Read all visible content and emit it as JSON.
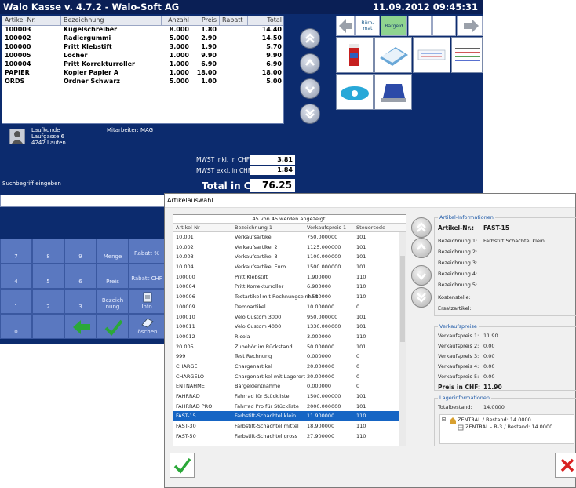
{
  "window": {
    "title": "Walo Kasse v. 4.7.2 - Walo-Soft AG",
    "datetime": "11.09.2012 09:45:31"
  },
  "cart": {
    "headers": [
      "Artikel-Nr.",
      "Bezeichnung",
      "Anzahl",
      "Preis",
      "Rabatt",
      "Total"
    ],
    "rows": [
      [
        "100003",
        "Kugelschreiber",
        "8.000",
        "1.80",
        "",
        "14.40"
      ],
      [
        "100002",
        "Radiergummi",
        "5.000",
        "2.90",
        "",
        "14.50"
      ],
      [
        "100000",
        "Pritt Klebstift",
        "3.000",
        "1.90",
        "",
        "5.70"
      ],
      [
        "100005",
        "Locher",
        "1.000",
        "9.90",
        "",
        "9.90"
      ],
      [
        "100004",
        "Pritt Korrekturroller",
        "1.000",
        "6.90",
        "",
        "6.90"
      ],
      [
        "PAPIER",
        "Kopier Papier A",
        "1.000",
        "18.00",
        "",
        "18.00"
      ],
      [
        "ORDS",
        "Ordner Schwarz",
        "5.000",
        "1.00",
        "",
        "5.00"
      ]
    ]
  },
  "customer": {
    "name": "Laufkunde",
    "street": "Laufgasse 6",
    "city": "4242 Laufen",
    "employee": "Mitarbeiter: MAG"
  },
  "totals": {
    "mwst_inkl_label": "MWST inkl. in CHF:",
    "mwst_inkl": "3.81",
    "mwst_exkl_label": "MWST exkl. in CHF:",
    "mwst_exkl": "1.84",
    "total_label": "Total in CHF:",
    "total": "76.25"
  },
  "search": {
    "label": "Suchbegriff eingeben",
    "value": ""
  },
  "keypad": {
    "row1": [
      "7",
      "8",
      "9",
      "Menge",
      "Rabatt %"
    ],
    "row2": [
      "4",
      "5",
      "6",
      "Preis",
      "Rabatt CHF"
    ],
    "row3": [
      "1",
      "2",
      "3",
      "Bezeich nung",
      "Info"
    ],
    "row4": [
      "0",
      ".",
      "",
      "",
      "löschen"
    ]
  },
  "tiles": {
    "buero": "Büro- mat",
    "bargeld": "Bargeld"
  },
  "dialog": {
    "title": "Artikelauswahl",
    "count": "45 von 45 werden angezeigt.",
    "headers": [
      "Artikel-Nr",
      "Bezeichnung 1",
      "Verkaufspreis 1",
      "Steuercode"
    ],
    "rows": [
      [
        "10.001",
        "Verkaufsartikel",
        "750.000000",
        "101"
      ],
      [
        "10.002",
        "Verkaufsartikel 2",
        "1125.000000",
        "101"
      ],
      [
        "10.003",
        "Verkaufsartikel 3",
        "1100.000000",
        "101"
      ],
      [
        "10.004",
        "Verkaufsartikel Euro",
        "1500.000000",
        "101"
      ],
      [
        "100000",
        "Pritt Klebstift",
        "1.900000",
        "110"
      ],
      [
        "100004",
        "Pritt Korrekturroller",
        "6.900000",
        "110"
      ],
      [
        "100006",
        "Testartikel mit Rechnungseinheit",
        "2.500000",
        "110"
      ],
      [
        "100009",
        "Demoartikel",
        "10.000000",
        "0"
      ],
      [
        "100010",
        "Velo Custom 3000",
        "950.000000",
        "101"
      ],
      [
        "100011",
        "Velo Custom 4000",
        "1330.000000",
        "101"
      ],
      [
        "100012",
        "Ricola",
        "3.000000",
        "110"
      ],
      [
        "20.005",
        "Zubehör im Rückstand",
        "50.000000",
        "101"
      ],
      [
        "999",
        "Test Rechnung",
        "0.000000",
        "0"
      ],
      [
        "CHARGE",
        "Chargenartikel",
        "20.000000",
        "0"
      ],
      [
        "CHARGELO",
        "Chargenartikel mit Lagerort",
        "20.000000",
        "0"
      ],
      [
        "ENTNAHME",
        "Bargeldentnahme",
        "0.000000",
        "0"
      ],
      [
        "FAHRRAD",
        "Fahrrad für Stückliste",
        "1500.000000",
        "101"
      ],
      [
        "FAHRRAD PRO",
        "Fahrrad Pro für Stückliste",
        "2000.000000",
        "101"
      ],
      [
        "FAST-15",
        "Farbstift-Schachtel klein",
        "11.900000",
        "110"
      ],
      [
        "FAST-30",
        "Farbstift-Schachtel mittel",
        "18.900000",
        "110"
      ],
      [
        "FAST-50",
        "Farbstift-Schachtel gross",
        "27.900000",
        "110"
      ]
    ],
    "info": {
      "group1": "Artikel-Informationen",
      "artikel_nr_label": "Artikel-Nr.:",
      "artikel_nr": "FAST-15",
      "bez1_label": "Bezeichnung 1:",
      "bez1": "Farbstift Schachtel klein",
      "bez2_label": "Bezeichnung 2:",
      "bez3_label": "Bezeichnung 3:",
      "bez4_label": "Bezeichnung 4:",
      "bez5_label": "Bezeichnung 5:",
      "kst_label": "Kostenstelle:",
      "ersatz_label": "Ersatzartikel:",
      "group2": "Verkaufspreise",
      "vp1_label": "Verkaufspreis 1:",
      "vp1": "11.90",
      "vp2_label": "Verkaufspreis 2:",
      "vp2": "0.00",
      "vp3_label": "Verkaufspreis 3:",
      "vp3": "0.00",
      "vp4_label": "Verkaufspreis 4:",
      "vp4": "0.00",
      "vp5_label": "Verkaufspreis 5:",
      "vp5": "0.00",
      "preis_label": "Preis in CHF:",
      "preis": "11.90",
      "group3": "Lagerinformationen",
      "total_label": "Totalbestand:",
      "total": "14.0000",
      "tree1": "ZENTRAL / Bestand: 14.0000",
      "tree2": "ZENTRAL - B-3 / Bestand: 14.0000"
    }
  }
}
